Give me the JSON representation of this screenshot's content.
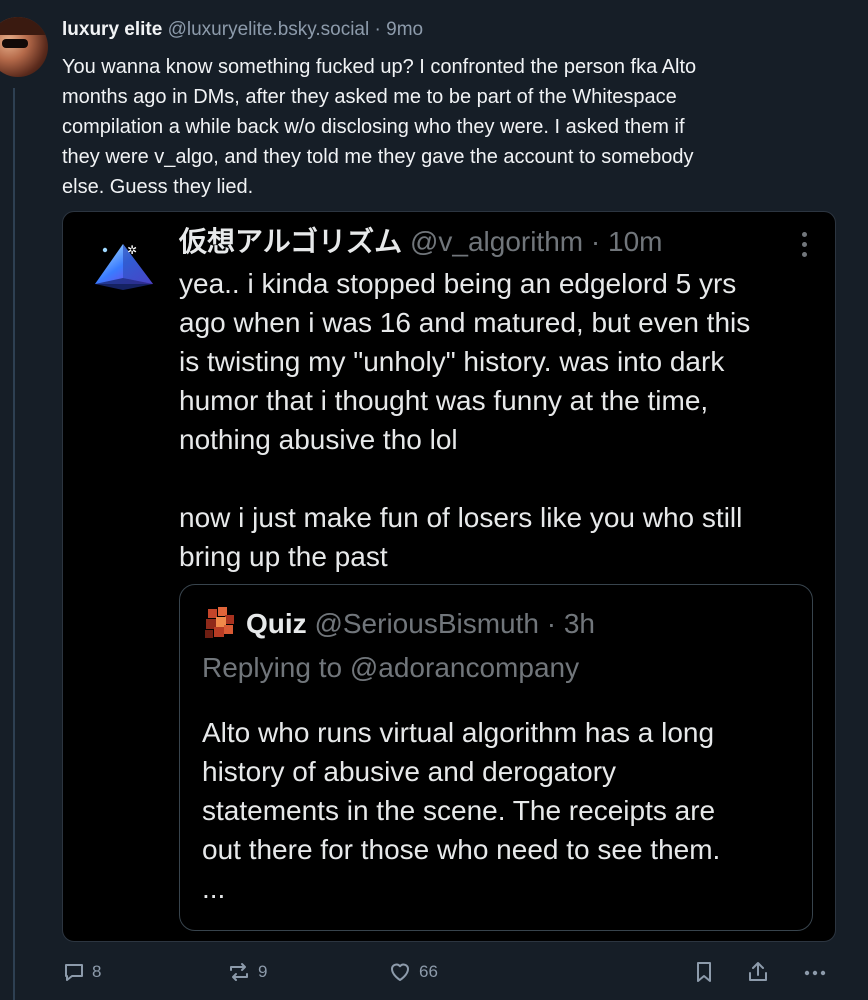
{
  "post": {
    "author_name": "luxury elite",
    "author_handle": "@luxuryelite.bsky.social",
    "separator": "·",
    "time": "9mo",
    "text": "You wanna know something fucked up? I confronted the person fka Alto\nmonths ago in DMs, after they asked me to be part of the Whitespace\ncompilation a while back w/o disclosing who they were. I asked them if\nthey were v_algo, and they told me they gave the account to somebody\nelse. Guess they lied."
  },
  "embed": {
    "author_name": "仮想アルゴリズム",
    "author_handle": "@v_algorithm",
    "separator": "·",
    "time": "10m",
    "text": "yea.. i kinda stopped being an edgelord 5 yrs\nago when i was 16 and matured, but even this\nis twisting my \"unholy\" history. was into dark\nhumor that i thought was funny at the time,\nnothing abusive tho lol\n\nnow i just make fun of losers like you who still\nbring up the past",
    "quote": {
      "author_name": "Quiz",
      "author_handle": "@SeriousBismuth",
      "separator": "·",
      "time": "3h",
      "replying_to": "Replying to @adorancompany",
      "text": "Alto who runs virtual algorithm has a long\nhistory of abusive and derogatory\nstatements in the scene. The receipts are\nout there for those who need to see them.\n..."
    }
  },
  "actions": {
    "reply_count": "8",
    "repost_count": "9",
    "like_count": "66"
  },
  "colors": {
    "background": "#161e27",
    "text": "#f1f3f5",
    "muted": "#8d9bab",
    "embed_background": "#000000"
  }
}
